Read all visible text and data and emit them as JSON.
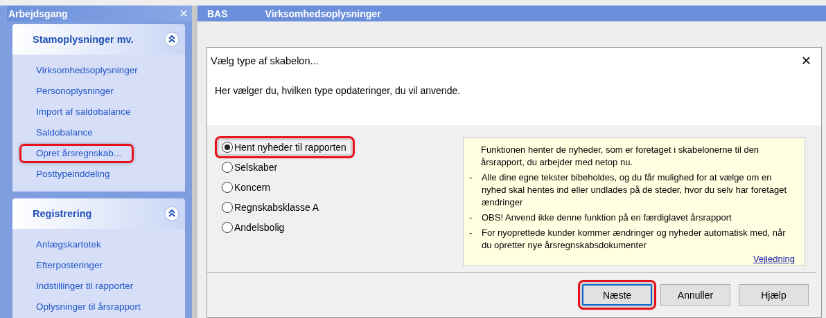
{
  "sidebar": {
    "title": "Arbejdsgang",
    "close": "×",
    "panels": [
      {
        "title": "Stamoplysninger mv.",
        "expanded": true,
        "items": [
          {
            "label": "Virksomhedsoplysninger",
            "highlighted": false
          },
          {
            "label": "Personoplysninger",
            "highlighted": false
          },
          {
            "label": "Import af saldobalance",
            "highlighted": false
          },
          {
            "label": "Saldobalance",
            "highlighted": false
          },
          {
            "label": "Opret årsregnskab...",
            "highlighted": true
          },
          {
            "label": "Posttypeinddeling",
            "highlighted": false
          }
        ]
      },
      {
        "title": "Registrering",
        "expanded": true,
        "items": [
          {
            "label": "Anlægskartotek",
            "highlighted": false
          },
          {
            "label": "Efterposteringer",
            "highlighted": false
          },
          {
            "label": "Indstillinger til rapporter",
            "highlighted": false
          },
          {
            "label": "Oplysninger til årsrapport",
            "highlighted": false
          }
        ]
      }
    ]
  },
  "main_header": {
    "app": "BAS",
    "title": "Virksomhedsoplysninger"
  },
  "dialog": {
    "title": "Vælg type af skabelon...",
    "close": "✕",
    "instruction": "Her vælger du, hvilken type opdateringer, du vil anvende.",
    "options": [
      {
        "label": "Hent nyheder til rapporten",
        "selected": true,
        "highlighted": true
      },
      {
        "label": "Selskaber",
        "selected": false,
        "highlighted": false
      },
      {
        "label": "Koncern",
        "selected": false,
        "highlighted": false
      },
      {
        "label": "Regnskabsklasse A",
        "selected": false,
        "highlighted": false
      },
      {
        "label": "Andelsbolig",
        "selected": false,
        "highlighted": false
      }
    ],
    "info": {
      "intro": "Funktionen henter de nyheder, som er foretaget i skabelonerne til den årsrapport, du arbejder med netop nu.",
      "bullets": [
        {
          "marker": "-",
          "text": "Alle dine egne tekster bibeholdes, og du får mulighed for at vælge om en nyhed skal hentes ind eller undlades på de steder, hvor du selv har foretaget ændringer"
        },
        {
          "marker": "-",
          "text": "OBS! Anvend ikke denne funktion på en færdiglavet årsrapport"
        },
        {
          "marker": "-",
          "text": "For nyoprettede kunder kommer ændringer og nyheder automatisk med, når du opretter nye årsregnskabsdokumenter"
        }
      ],
      "link": "Vejledning"
    },
    "buttons": [
      {
        "label": "Næste",
        "default": true,
        "highlighted": true
      },
      {
        "label": "Annuller",
        "default": false,
        "highlighted": false
      },
      {
        "label": "Hjælp",
        "default": false,
        "highlighted": false
      }
    ]
  }
}
